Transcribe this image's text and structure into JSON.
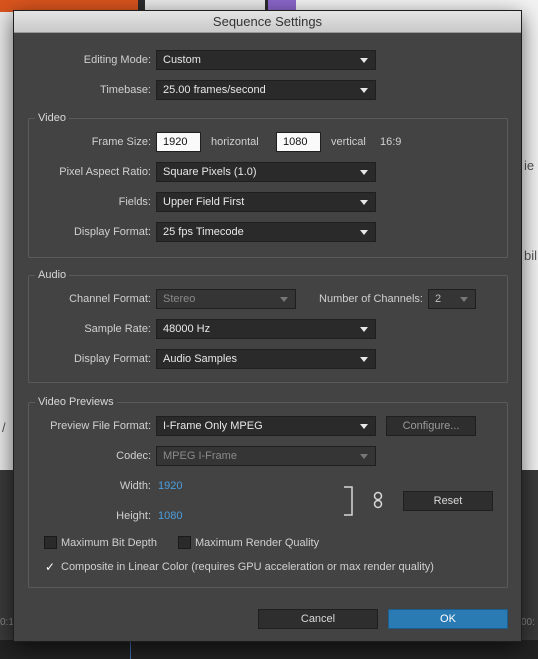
{
  "dialog": {
    "title": "Sequence Settings",
    "editing_mode": {
      "label": "Editing Mode:",
      "value": "Custom"
    },
    "timebase": {
      "label": "Timebase:",
      "value": "25.00  frames/second"
    },
    "video": {
      "group_title": "Video",
      "frame_size": {
        "label": "Frame Size:",
        "horizontal": "1920",
        "horizontal_label": "horizontal",
        "vertical": "1080",
        "vertical_label": "vertical",
        "aspect": "16:9"
      },
      "pixel_aspect": {
        "label": "Pixel Aspect Ratio:",
        "value": "Square Pixels (1.0)"
      },
      "fields": {
        "label": "Fields:",
        "value": "Upper Field First"
      },
      "display_format": {
        "label": "Display Format:",
        "value": "25 fps Timecode"
      }
    },
    "audio": {
      "group_title": "Audio",
      "channel_format": {
        "label": "Channel Format:",
        "value": "Stereo"
      },
      "num_channels": {
        "label": "Number of Channels:",
        "value": "2"
      },
      "sample_rate": {
        "label": "Sample Rate:",
        "value": "48000 Hz"
      },
      "display_format": {
        "label": "Display Format:",
        "value": "Audio Samples"
      }
    },
    "previews": {
      "group_title": "Video Previews",
      "file_format": {
        "label": "Preview File Format:",
        "value": "I-Frame Only MPEG"
      },
      "configure_label": "Configure...",
      "codec": {
        "label": "Codec:",
        "value": "MPEG I-Frame"
      },
      "width": {
        "label": "Width:",
        "value": "1920"
      },
      "height": {
        "label": "Height:",
        "value": "1080"
      },
      "reset_label": "Reset",
      "max_bit_depth": {
        "label": "Maximum Bit Depth",
        "checked": false
      },
      "max_render_quality": {
        "label": "Maximum Render Quality",
        "checked": false
      },
      "composite_linear": {
        "label": "Composite in Linear Color (requires GPU acceleration or max render quality)",
        "checked": true,
        "mark": "✓"
      }
    },
    "cancel_label": "Cancel",
    "ok_label": "OK"
  },
  "background": {
    "fragments": [
      "ie",
      "bil",
      "/",
      "0:1",
      "00:"
    ]
  },
  "colors": {
    "accent": "#2a7ab3",
    "value_blue": "#4a9fe0",
    "dialog_bg": "#434343"
  }
}
